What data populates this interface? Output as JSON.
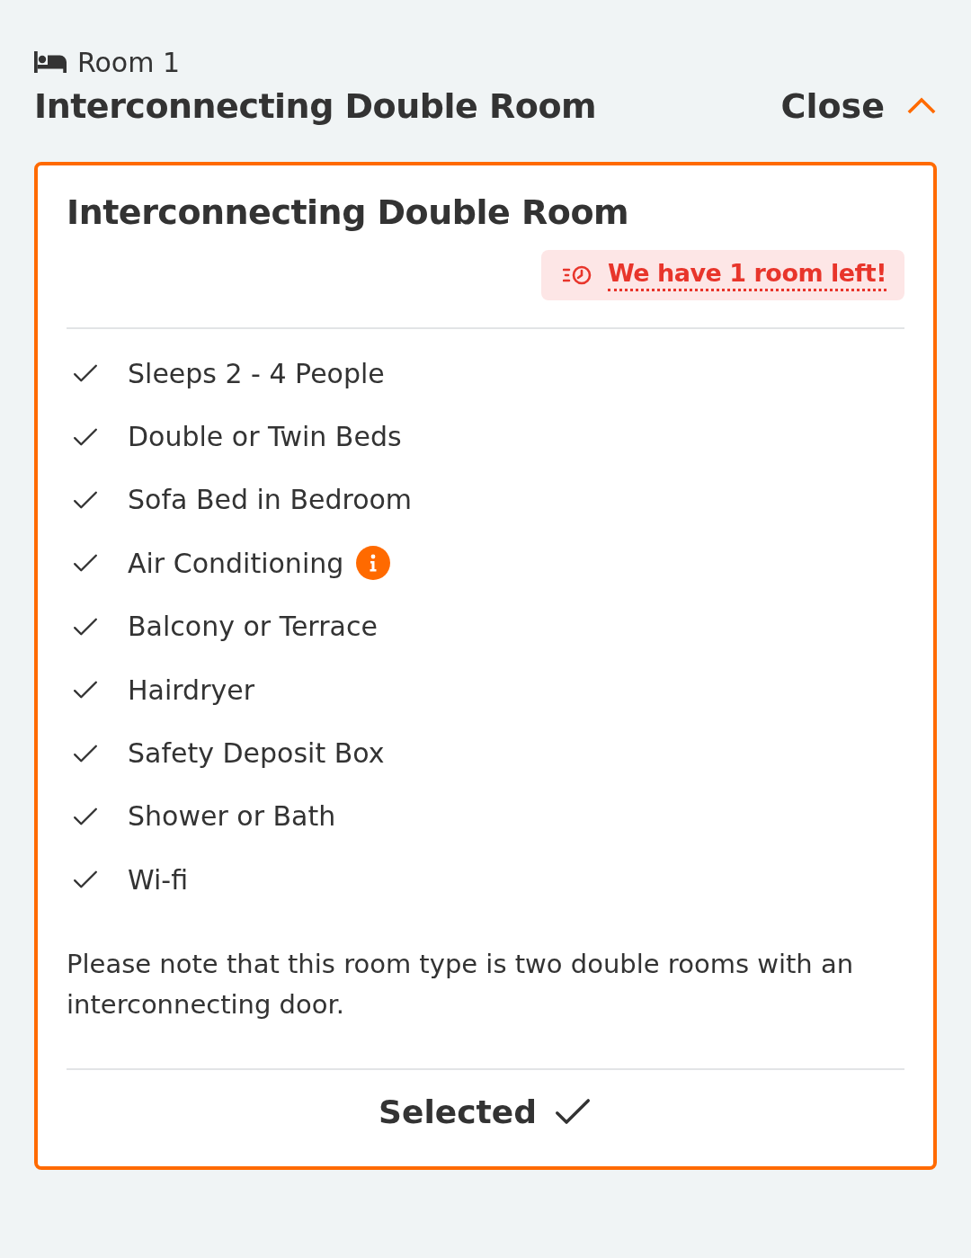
{
  "room_label": "Room 1",
  "room_name": "Interconnecting Double Room",
  "toggle": {
    "label": "Close",
    "expanded": true
  },
  "card": {
    "title": "Interconnecting Double Room",
    "selected": true,
    "availability": "We have 1 room left!",
    "features": [
      {
        "label": "Sleeps 2 - 4 People",
        "info": false
      },
      {
        "label": "Double or Twin Beds",
        "info": false
      },
      {
        "label": "Sofa Bed in Bedroom",
        "info": false
      },
      {
        "label": "Air Conditioning",
        "info": true
      },
      {
        "label": "Balcony or Terrace",
        "info": false
      },
      {
        "label": "Hairdryer",
        "info": false
      },
      {
        "label": "Safety Deposit Box",
        "info": false
      },
      {
        "label": "Shower or Bath",
        "info": false
      },
      {
        "label": "Wi-fi",
        "info": false
      }
    ],
    "note": "Please note that this room type is two double rooms with an interconnecting door.",
    "status": "Selected"
  }
}
